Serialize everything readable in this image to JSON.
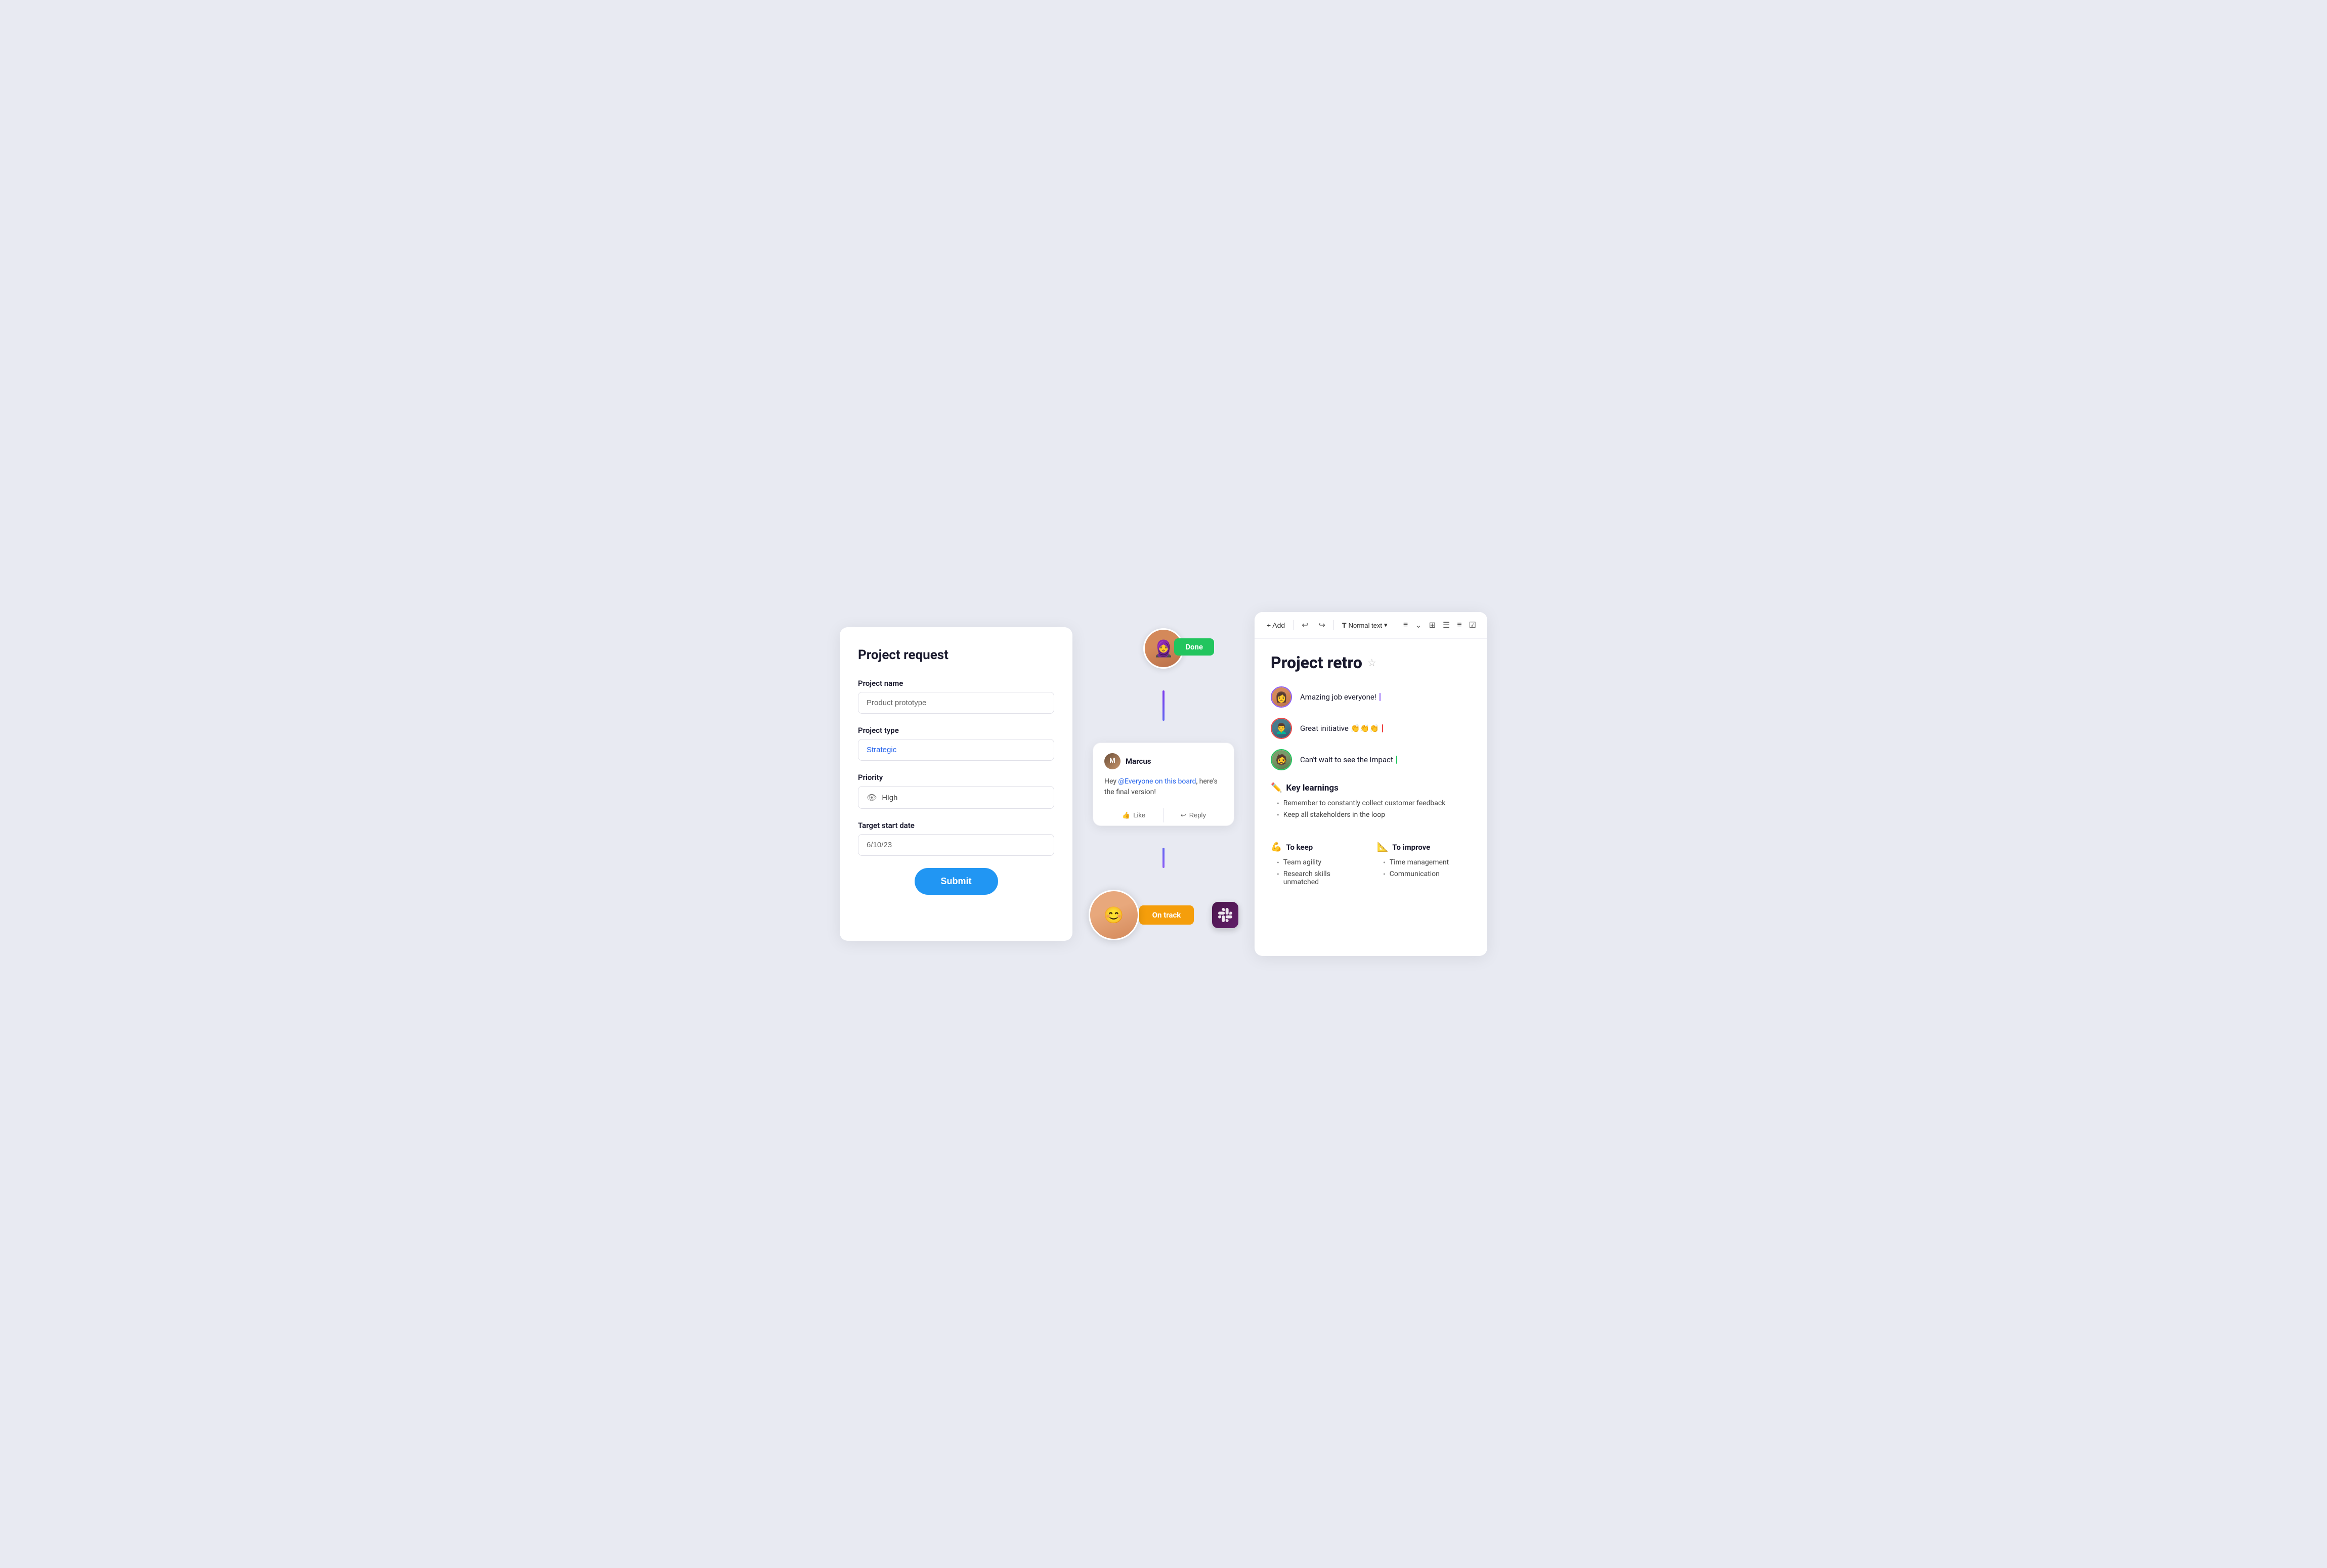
{
  "form": {
    "title": "Project request",
    "fields": {
      "project_name_label": "Project name",
      "project_name_value": "Product prototype",
      "project_type_label": "Project type",
      "project_type_value": "Strategic",
      "priority_label": "Priority",
      "priority_value": "High",
      "target_start_date_label": "Target start date",
      "target_start_date_value": "6/10/23"
    },
    "submit_label": "Submit"
  },
  "workflow": {
    "done_badge": "Done",
    "on_track_badge": "On track",
    "chat": {
      "author": "Marcus",
      "message_before": "Hey ",
      "mention": "@Everyone on this board",
      "message_after": ", here's the final version!",
      "like_label": "Like",
      "reply_label": "Reply"
    }
  },
  "doc": {
    "toolbar": {
      "add_label": "+ Add",
      "text_style": "Normal text",
      "undo": "↩",
      "redo": "↪"
    },
    "title": "Project retro",
    "star_icon": "☆",
    "comments": [
      {
        "text": "Amazing job everyone!",
        "cursor_color": "purple"
      },
      {
        "text": "Great initiative 👏👏👏",
        "cursor_color": "red"
      },
      {
        "text": "Can't wait to see the impact",
        "cursor_color": "green"
      }
    ],
    "key_learnings": {
      "heading": "Key learnings",
      "emoji": "✏️",
      "items": [
        "Remember to constantly collect customer feedback",
        "Keep all stakeholders in the loop"
      ]
    },
    "to_keep": {
      "heading": "To keep",
      "emoji": "💪",
      "items": [
        "Team agility",
        "Research skills unmatched"
      ]
    },
    "to_improve": {
      "heading": "To improve",
      "emoji": "📐",
      "items": [
        "Time management",
        "Communication"
      ]
    }
  }
}
